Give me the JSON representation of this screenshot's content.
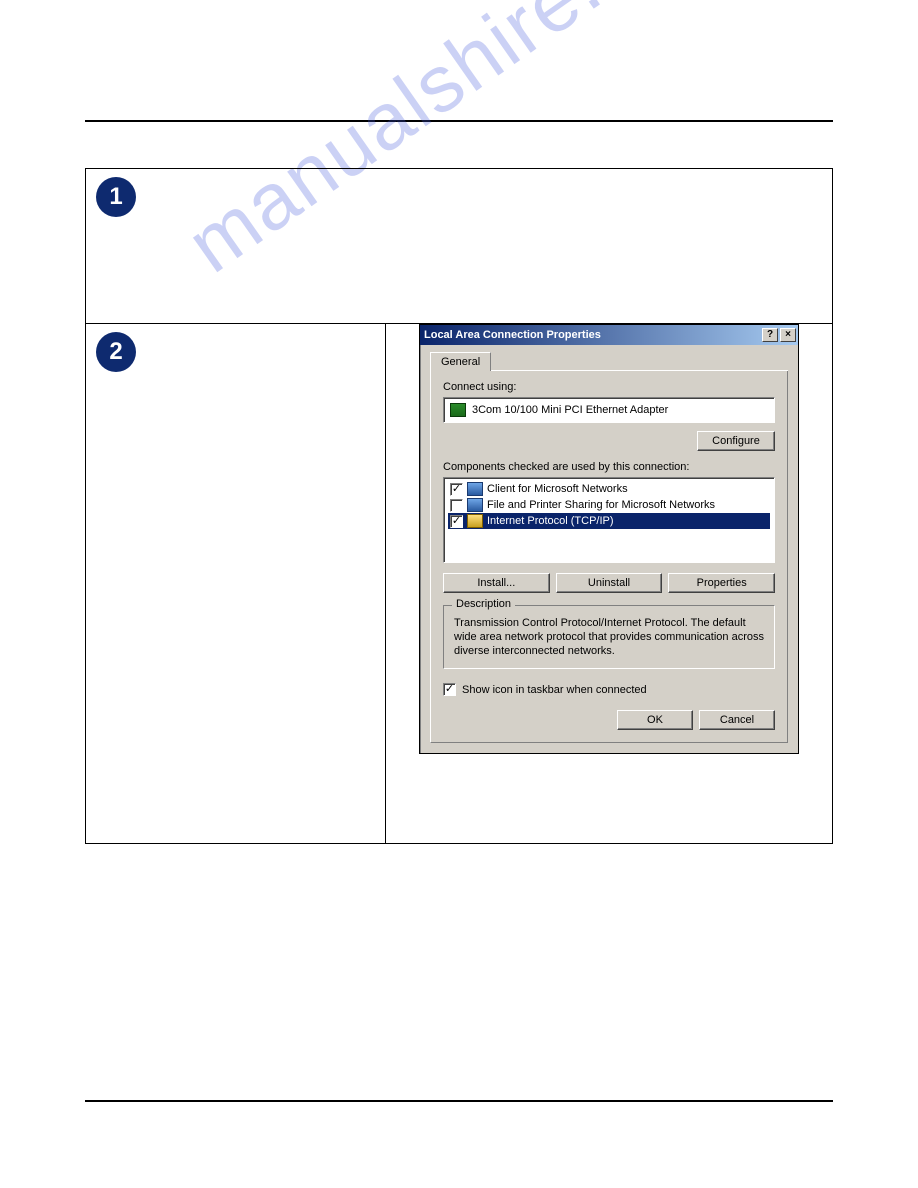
{
  "watermark": "manualshire.com",
  "steps": {
    "one": "1",
    "two": "2"
  },
  "dialog": {
    "title": "Local Area Connection Properties",
    "help_btn": "?",
    "close_btn": "×",
    "tab_general": "General",
    "connect_using_label": "Connect using:",
    "adapter_name": "3Com 10/100 Mini PCI Ethernet Adapter",
    "configure_btn": "Configure",
    "components_label": "Components checked are used by this connection:",
    "components": [
      {
        "checked": true,
        "label": "Client for Microsoft Networks",
        "icon": "monitor",
        "selected": false
      },
      {
        "checked": false,
        "label": "File and Printer Sharing for Microsoft Networks",
        "icon": "monitor",
        "selected": false
      },
      {
        "checked": true,
        "label": "Internet Protocol (TCP/IP)",
        "icon": "protocol",
        "selected": true
      }
    ],
    "install_btn": "Install...",
    "uninstall_btn": "Uninstall",
    "properties_btn": "Properties",
    "description_group": "Description",
    "description_text": "Transmission Control Protocol/Internet Protocol. The default wide area network protocol that provides communication across diverse interconnected networks.",
    "show_icon_checked": true,
    "show_icon_label": "Show icon in taskbar when connected",
    "ok_btn": "OK",
    "cancel_btn": "Cancel"
  }
}
